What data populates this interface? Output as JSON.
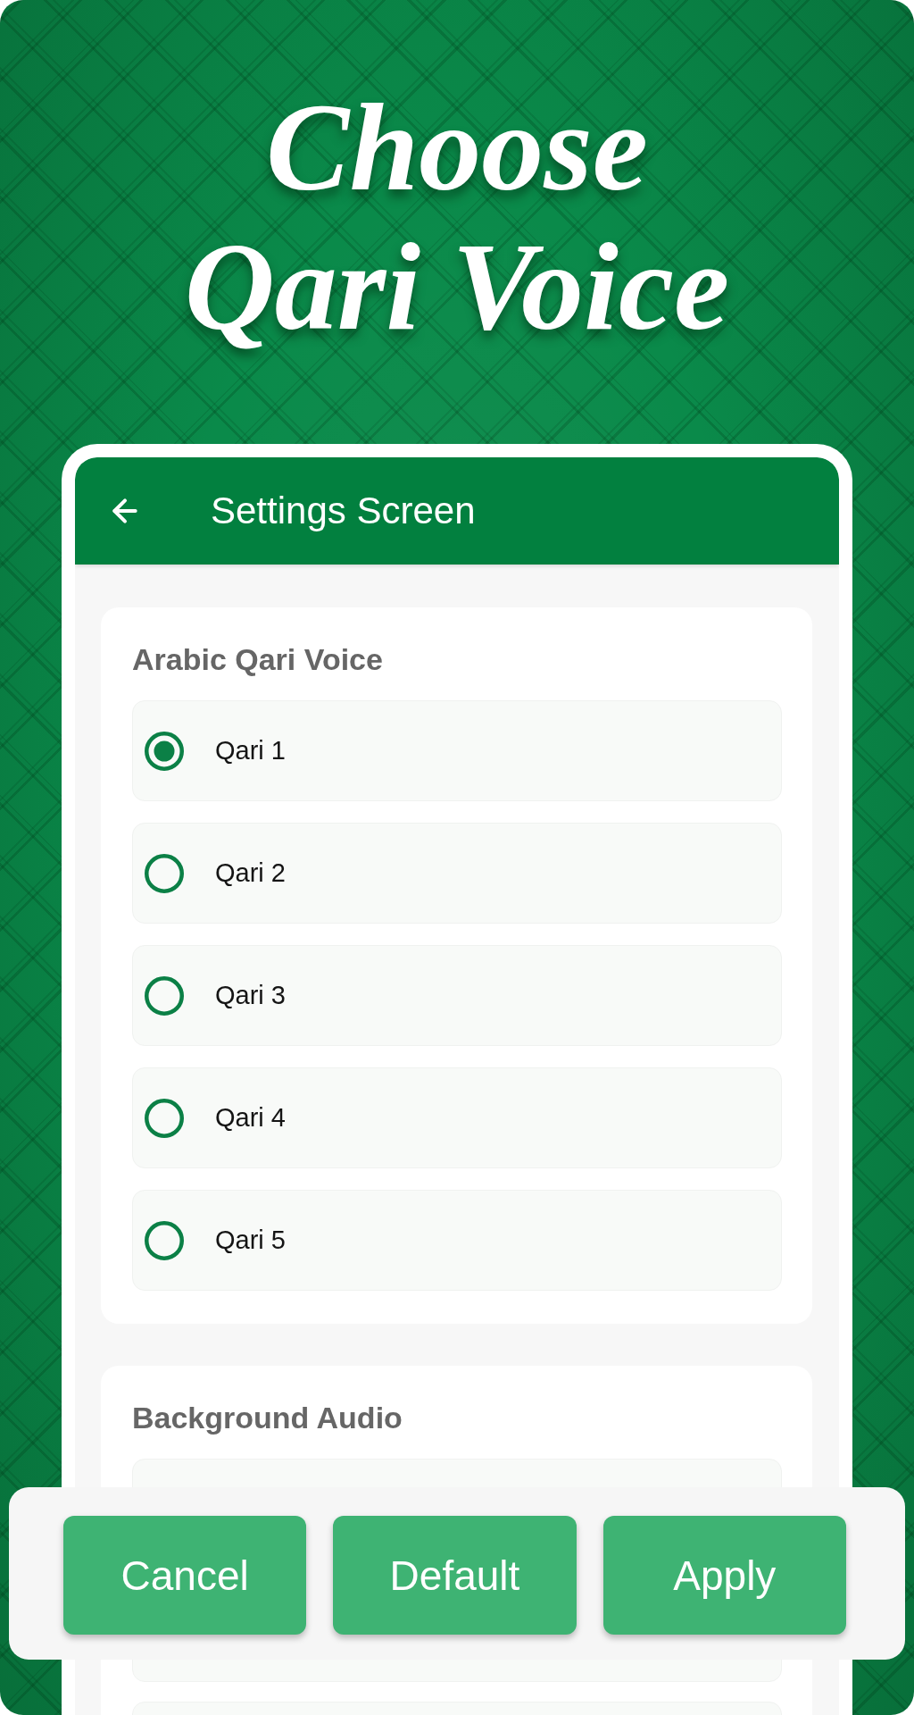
{
  "hero": {
    "title_lines": [
      "Choose",
      "Qari Voice"
    ]
  },
  "app_bar": {
    "title": "Settings Screen"
  },
  "sections": [
    {
      "title": "Arabic Qari Voice",
      "options": [
        {
          "label": "Qari 1",
          "selected": true
        },
        {
          "label": "Qari 2",
          "selected": false
        },
        {
          "label": "Qari 3",
          "selected": false
        },
        {
          "label": "Qari 4",
          "selected": false
        },
        {
          "label": "Qari 5",
          "selected": false
        }
      ]
    },
    {
      "title": "Background Audio"
    }
  ],
  "buttons": [
    {
      "label": "Cancel"
    },
    {
      "label": "Default"
    },
    {
      "label": "Apply"
    }
  ]
}
